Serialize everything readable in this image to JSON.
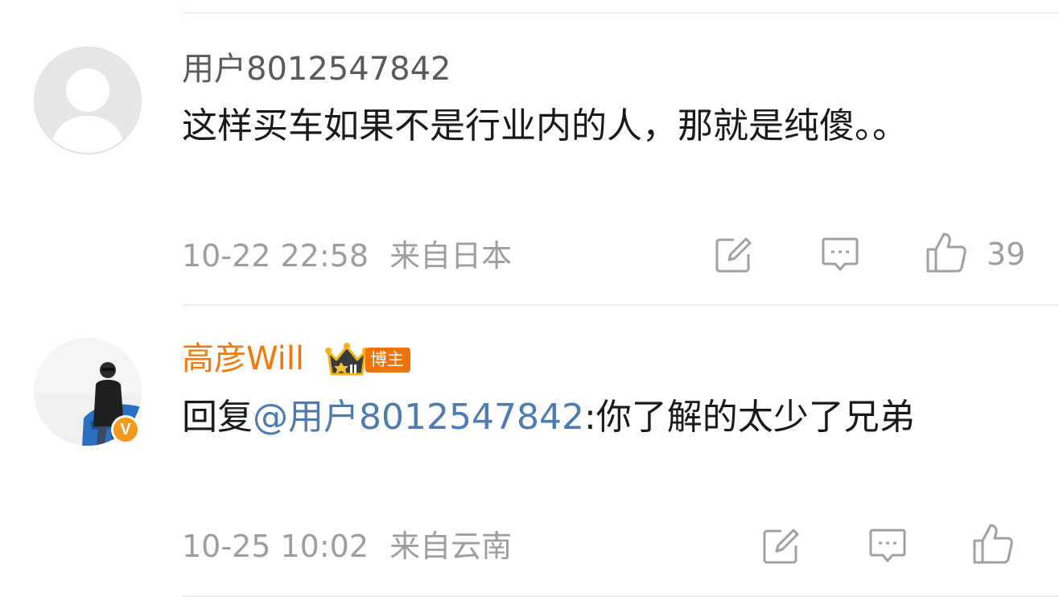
{
  "comments": [
    {
      "username": "用户8012547842",
      "username_color": "#5a5a5a",
      "text": "这样买车如果不是行业内的人，那就是纯傻。。",
      "timestamp": "10-22 22:58",
      "location": "来自日本",
      "like_count": "39",
      "avatar": "default-avatar"
    },
    {
      "username": "高彦Will",
      "username_color": "#f07a0a",
      "badge_label": "博主",
      "reply_prefix": "回复",
      "mention": "@用户8012547842",
      "text": ":你了解的太少了兄弟",
      "timestamp": "10-25 10:02",
      "location": "来自云南",
      "like_count": "",
      "avatar": "user-photo-avatar",
      "verified_mark": "V"
    }
  ],
  "colors": {
    "mention": "#4e7bb0",
    "meta": "#9e9e9e",
    "verified": "#f39a1e",
    "badge": "#f0720a"
  }
}
